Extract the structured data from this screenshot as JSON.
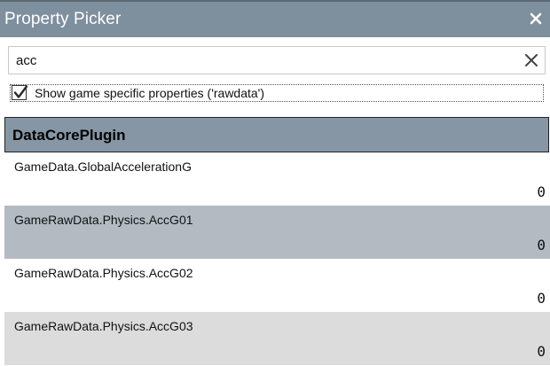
{
  "window": {
    "title": "Property Picker",
    "close_icon": "close-icon"
  },
  "search": {
    "value": "acc",
    "placeholder": "",
    "clear_icon": "clear-icon"
  },
  "options": {
    "rawdata_checkbox_label": "Show game specific properties ('rawdata')",
    "rawdata_checked": true
  },
  "group": {
    "title": "DataCorePlugin"
  },
  "properties": [
    {
      "name": "GameData.GlobalAccelerationG",
      "value": "0",
      "background": "#ffffff"
    },
    {
      "name": "GameRawData.Physics.AccG01",
      "value": "0",
      "background": "#b3bac2"
    },
    {
      "name": "GameRawData.Physics.AccG02",
      "value": "0",
      "background": "#ffffff"
    },
    {
      "name": "GameRawData.Physics.AccG03",
      "value": "0",
      "background": "#dcdcdc"
    }
  ],
  "colors": {
    "titlebar": "#7e8f9e",
    "group_header": "#8696a4",
    "selected_row": "#b3bac2",
    "hover_row": "#dcdcdc"
  }
}
